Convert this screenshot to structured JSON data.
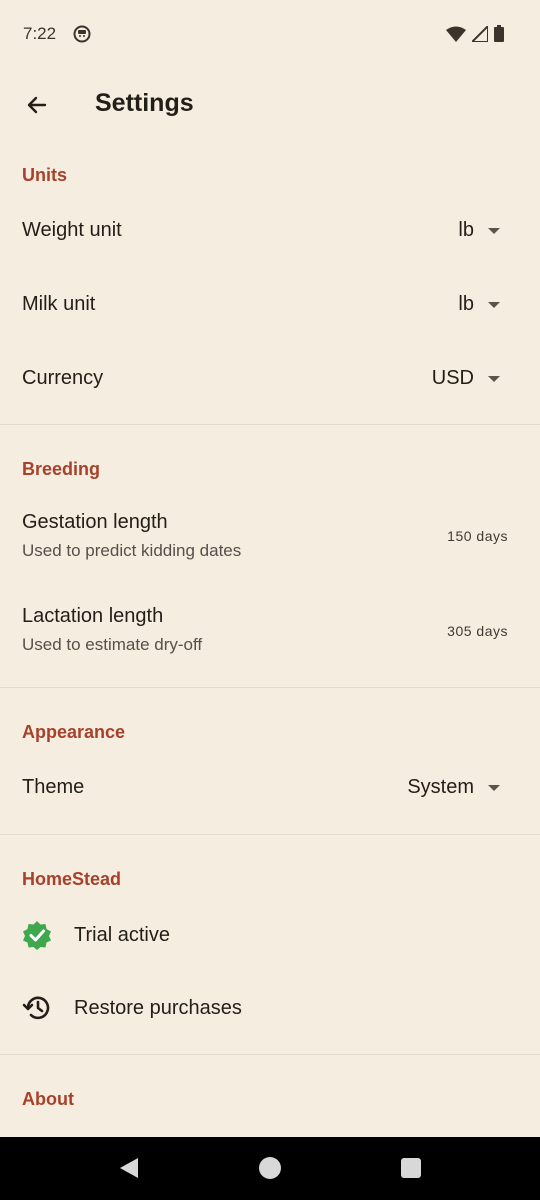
{
  "status": {
    "time": "7:22"
  },
  "header": {
    "title": "Settings"
  },
  "units": {
    "title": "Units",
    "weight": {
      "label": "Weight unit",
      "value": "lb"
    },
    "milk": {
      "label": "Milk unit",
      "value": "lb"
    },
    "currency": {
      "label": "Currency",
      "value": "USD"
    }
  },
  "breeding": {
    "title": "Breeding",
    "gestation": {
      "label": "Gestation length",
      "sub": "Used to predict kidding dates",
      "value": "150 days"
    },
    "lactation": {
      "label": "Lactation length",
      "sub": "Used to estimate dry-off",
      "value": "305 days"
    }
  },
  "appearance": {
    "title": "Appearance",
    "theme": {
      "label": "Theme",
      "value": "System"
    }
  },
  "homestead": {
    "title": "HomeStead",
    "trial": "Trial active",
    "restore": "Restore purchases"
  },
  "about": {
    "title": "About"
  },
  "colors": {
    "accent": "#a8412b",
    "background": "#f5ede0",
    "check": "#3fa84f"
  }
}
